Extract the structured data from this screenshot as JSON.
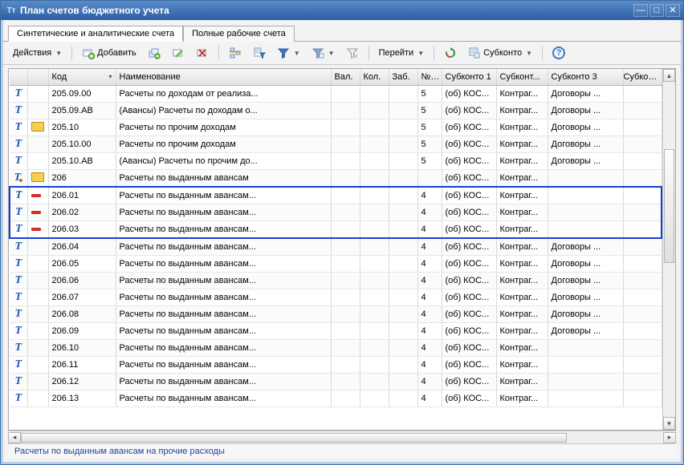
{
  "window": {
    "title": "План счетов бюджетного учета"
  },
  "tabs": [
    {
      "label": "Синтетические и аналитические счета",
      "active": true
    },
    {
      "label": "Полные рабочие счета",
      "active": false
    }
  ],
  "toolbar": {
    "actions": "Действия",
    "add": "Добавить",
    "go": "Перейти",
    "subconto": "Субконто"
  },
  "columns": {
    "code": "Код",
    "name": "Наименование",
    "val": "Вал.",
    "kol": "Кол.",
    "zab": "Заб.",
    "n": "№ ...",
    "s1": "Субконто 1",
    "s2": "Субконт...",
    "s3": "Субконто 3",
    "s4": "Субконт..."
  },
  "rows": [
    {
      "t": "T",
      "ico": "",
      "code": "205.09.00",
      "name": "Расчеты по доходам от реализа...",
      "n": "5",
      "s1": "(об) КОС...",
      "s2": "Контраг...",
      "s3": "Договоры ..."
    },
    {
      "t": "T",
      "ico": "",
      "code": "205.09.АВ",
      "name": "(Авансы) Расчеты по доходам о...",
      "n": "5",
      "s1": "(об) КОС...",
      "s2": "Контраг...",
      "s3": "Договоры ..."
    },
    {
      "t": "T",
      "ico": "folder",
      "code": "205.10",
      "name": "Расчеты по прочим доходам",
      "n": "5",
      "s1": "(об) КОС...",
      "s2": "Контраг...",
      "s3": "Договоры ..."
    },
    {
      "t": "T",
      "ico": "",
      "code": "205.10.00",
      "name": "Расчеты по прочим доходам",
      "n": "5",
      "s1": "(об) КОС...",
      "s2": "Контраг...",
      "s3": "Договоры ..."
    },
    {
      "t": "T",
      "ico": "",
      "code": "205.10.АВ",
      "name": "(Авансы) Расчеты по прочим до...",
      "n": "5",
      "s1": "(об) КОС...",
      "s2": "Контраг...",
      "s3": "Договоры ..."
    },
    {
      "t": "T.",
      "ico": "folder",
      "code": "206",
      "name": "Расчеты по выданным авансам",
      "n": "",
      "s1": "(об) КОС...",
      "s2": "Контраг...",
      "s3": ""
    },
    {
      "t": "T",
      "ico": "minus",
      "code": "206.01",
      "name": "Расчеты по выданным авансам...",
      "n": "4",
      "s1": "(об) КОС...",
      "s2": "Контраг...",
      "s3": "",
      "sel": "top"
    },
    {
      "t": "T",
      "ico": "minus",
      "code": "206.02",
      "name": "Расчеты по выданным авансам...",
      "n": "4",
      "s1": "(об) КОС...",
      "s2": "Контраг...",
      "s3": "",
      "sel": "mid"
    },
    {
      "t": "T",
      "ico": "minus",
      "code": "206.03",
      "name": "Расчеты по выданным авансам...",
      "n": "4",
      "s1": "(об) КОС...",
      "s2": "Контраг...",
      "s3": "",
      "sel": "bot"
    },
    {
      "t": "T",
      "ico": "",
      "code": "206.04",
      "name": "Расчеты по выданным авансам...",
      "n": "4",
      "s1": "(об) КОС...",
      "s2": "Контраг...",
      "s3": "Договоры ..."
    },
    {
      "t": "T",
      "ico": "",
      "code": "206.05",
      "name": "Расчеты по выданным авансам...",
      "n": "4",
      "s1": "(об) КОС...",
      "s2": "Контраг...",
      "s3": "Договоры ..."
    },
    {
      "t": "T",
      "ico": "",
      "code": "206.06",
      "name": "Расчеты по выданным авансам...",
      "n": "4",
      "s1": "(об) КОС...",
      "s2": "Контраг...",
      "s3": "Договоры ..."
    },
    {
      "t": "T",
      "ico": "",
      "code": "206.07",
      "name": "Расчеты по выданным авансам...",
      "n": "4",
      "s1": "(об) КОС...",
      "s2": "Контраг...",
      "s3": "Договоры ..."
    },
    {
      "t": "T",
      "ico": "",
      "code": "206.08",
      "name": "Расчеты по выданным авансам...",
      "n": "4",
      "s1": "(об) КОС...",
      "s2": "Контраг...",
      "s3": "Договоры ..."
    },
    {
      "t": "T",
      "ico": "",
      "code": "206.09",
      "name": "Расчеты по выданным авансам...",
      "n": "4",
      "s1": "(об) КОС...",
      "s2": "Контраг...",
      "s3": "Договоры ..."
    },
    {
      "t": "T",
      "ico": "",
      "code": "206.10",
      "name": "Расчеты по выданным авансам...",
      "n": "4",
      "s1": "(об) КОС...",
      "s2": "Контраг...",
      "s3": ""
    },
    {
      "t": "T",
      "ico": "",
      "code": "206.11",
      "name": "Расчеты по выданным авансам...",
      "n": "4",
      "s1": "(об) КОС...",
      "s2": "Контраг...",
      "s3": ""
    },
    {
      "t": "T",
      "ico": "",
      "code": "206.12",
      "name": "Расчеты по выданным авансам...",
      "n": "4",
      "s1": "(об) КОС...",
      "s2": "Контраг...",
      "s3": ""
    },
    {
      "t": "T",
      "ico": "",
      "code": "206.13",
      "name": "Расчеты по выданным авансам...",
      "n": "4",
      "s1": "(об) КОС...",
      "s2": "Контраг...",
      "s3": ""
    }
  ],
  "status": "Расчеты по выданным авансам на прочие расходы"
}
